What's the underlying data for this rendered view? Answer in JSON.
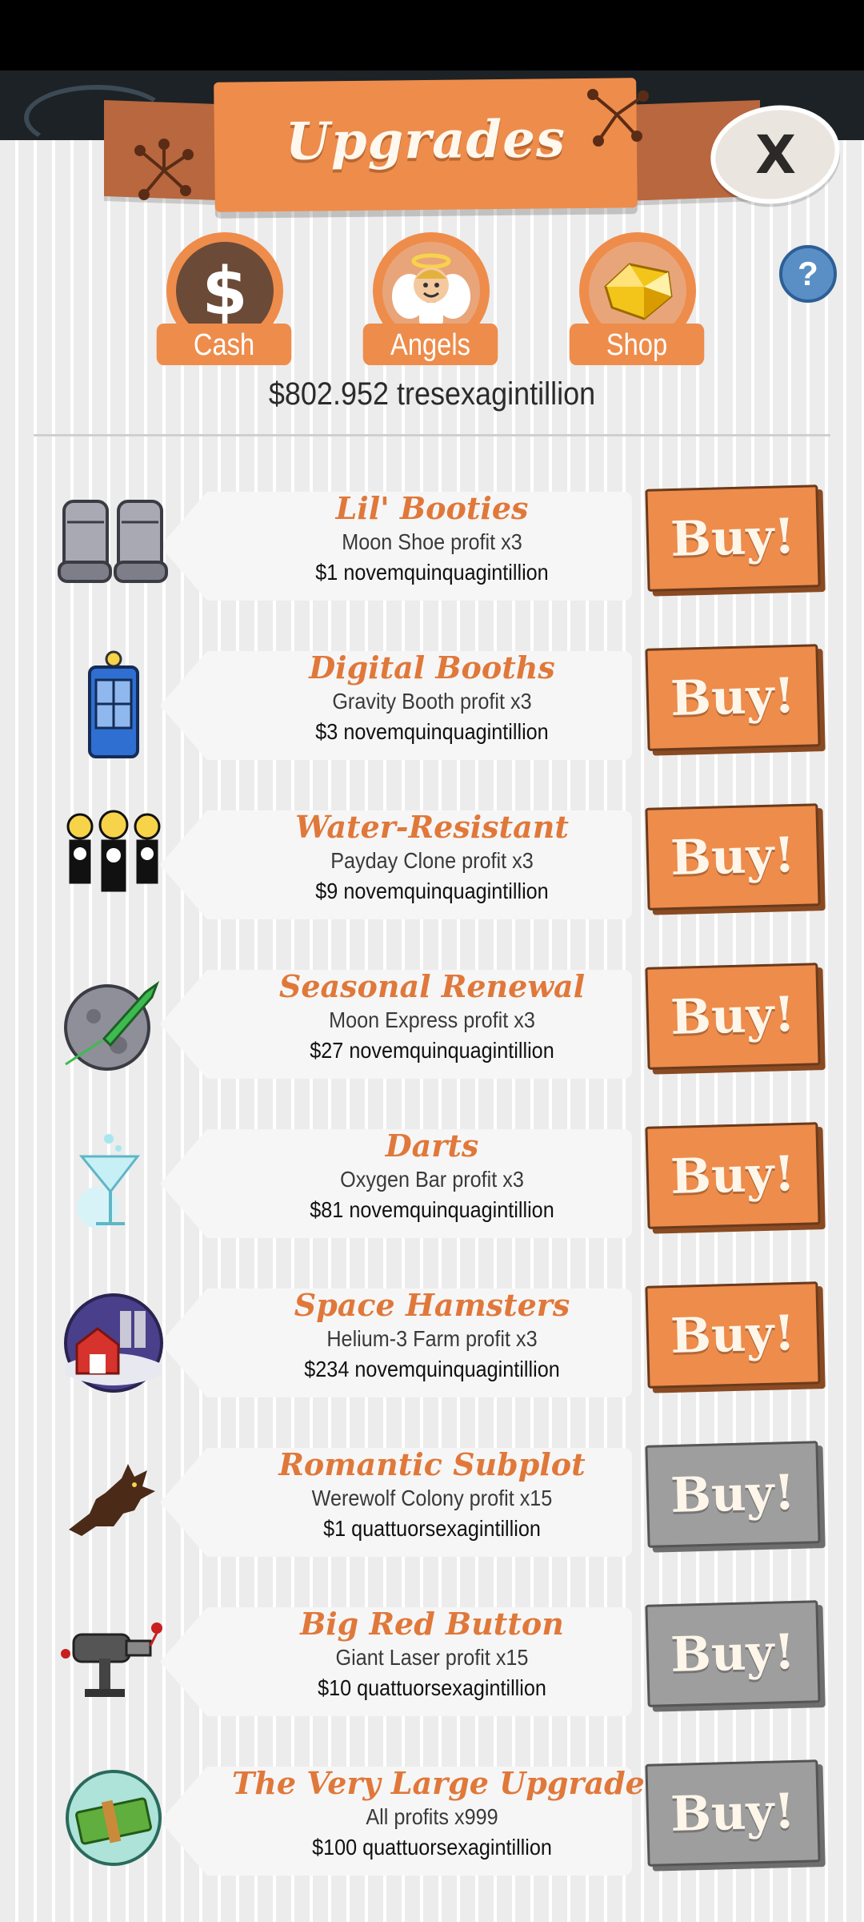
{
  "header": {
    "title": "Upgrades",
    "close_label": "X"
  },
  "tabs": [
    {
      "label": "Cash",
      "icon": "dollar-icon"
    },
    {
      "label": "Angels",
      "icon": "angel-icon"
    },
    {
      "label": "Shop",
      "icon": "gold-gem-icon"
    }
  ],
  "help_label": "?",
  "balance": "$802.952 tresexagintillion",
  "upgrades": [
    {
      "name": "Lil' Booties",
      "desc": "Moon Shoe profit x3",
      "cost": "$1 novemquinquagintillion",
      "buy_label": "Buy!",
      "enabled": true,
      "icon": "moon-boots-icon"
    },
    {
      "name": "Digital Booths",
      "desc": "Gravity Booth profit x3",
      "cost": "$3 novemquinquagintillion",
      "buy_label": "Buy!",
      "enabled": true,
      "icon": "gravity-booth-icon"
    },
    {
      "name": "Water-Resistant",
      "desc": "Payday Clone profit x3",
      "cost": "$9 novemquinquagintillion",
      "buy_label": "Buy!",
      "enabled": true,
      "icon": "clones-icon"
    },
    {
      "name": "Seasonal Renewal",
      "desc": "Moon Express profit x3",
      "cost": "$27 novemquinquagintillion",
      "buy_label": "Buy!",
      "enabled": true,
      "icon": "moon-rocket-icon"
    },
    {
      "name": "Darts",
      "desc": "Oxygen Bar profit x3",
      "cost": "$81 novemquinquagintillion",
      "buy_label": "Buy!",
      "enabled": true,
      "icon": "cocktail-glass-icon"
    },
    {
      "name": "Space Hamsters",
      "desc": "Helium-3 Farm profit x3",
      "cost": "$234 novemquinquagintillion",
      "buy_label": "Buy!",
      "enabled": true,
      "icon": "farm-barn-icon"
    },
    {
      "name": "Romantic Subplot",
      "desc": "Werewolf Colony profit x15",
      "cost": "$1 quattuorsexagintillion",
      "buy_label": "Buy!",
      "enabled": false,
      "icon": "werewolf-icon"
    },
    {
      "name": "Big Red Button",
      "desc": "Giant Laser profit x15",
      "cost": "$10 quattuorsexagintillion",
      "buy_label": "Buy!",
      "enabled": false,
      "icon": "ray-gun-icon"
    },
    {
      "name": "The Very Large Upgrade",
      "desc": "All profits x999",
      "cost": "$100 quattuorsexagintillion",
      "buy_label": "Buy!",
      "enabled": false,
      "icon": "cash-stack-icon"
    }
  ],
  "colors": {
    "accent": "#ee8c4b",
    "title_text": "#e0783a",
    "disabled": "#9e9e9e",
    "help": "#5a8fc6"
  }
}
